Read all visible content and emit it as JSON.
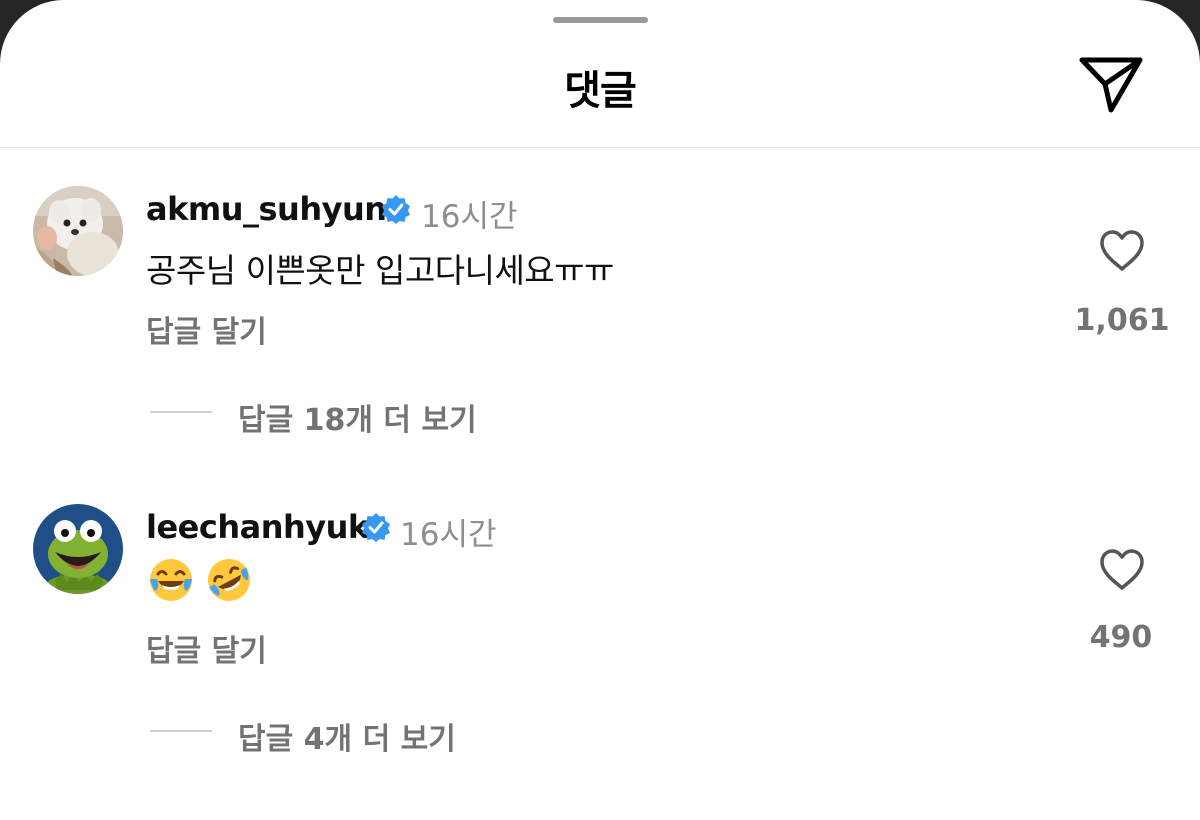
{
  "header": {
    "title": "댓글",
    "share_icon": "paper-plane-icon"
  },
  "comments": [
    {
      "username": "akmu_suhyun",
      "verified": true,
      "time": "16시간",
      "text": "공주님 이쁜옷만 입고다니세요ㅠㅠ",
      "reply_label": "답글 달기",
      "likes": "1,061",
      "view_replies": "답글 18개 더 보기",
      "avatar": "white-puppy-avatar"
    },
    {
      "username": "leechanhyuk",
      "verified": true,
      "time": "16시간",
      "emojis": [
        "face-with-tears-of-joy",
        "rolling-on-the-floor-laughing"
      ],
      "reply_label": "답글 달기",
      "likes": "490",
      "view_replies": "답글 4개 더 보기",
      "avatar": "green-frog-avatar"
    }
  ],
  "colors": {
    "verified": "#3897f0",
    "secondary_text": "#737373",
    "primary_text": "#111111"
  }
}
